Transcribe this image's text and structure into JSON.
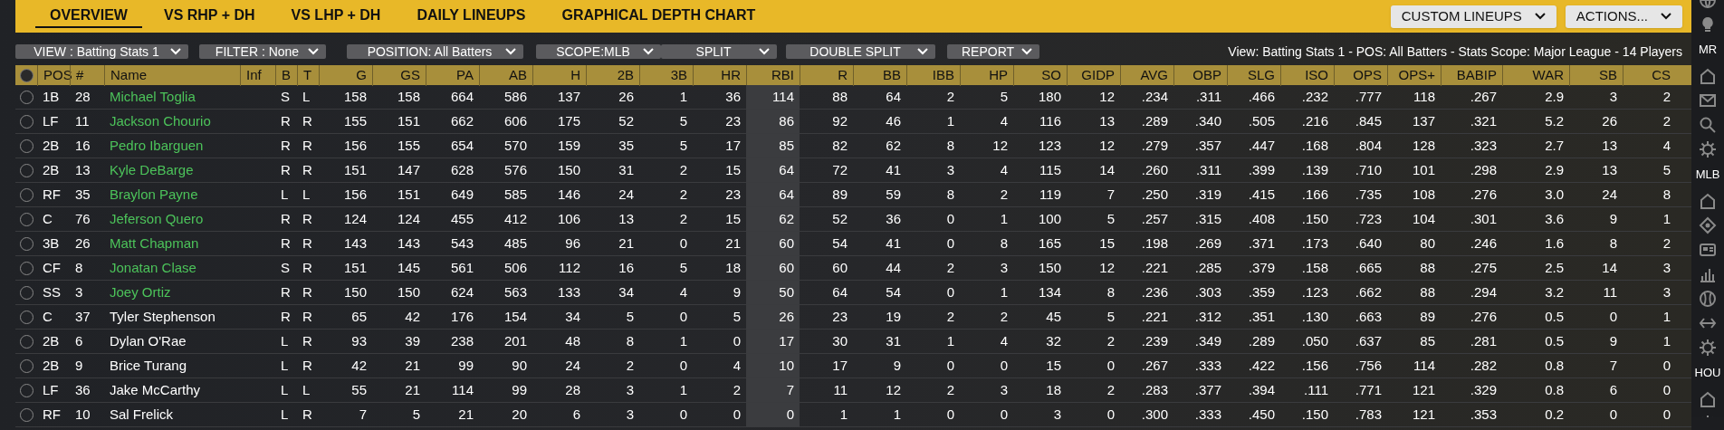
{
  "tabs": [
    {
      "label": "OVERVIEW",
      "selected": true
    },
    {
      "label": "VS RHP + DH",
      "selected": false
    },
    {
      "label": "VS LHP + DH",
      "selected": false
    },
    {
      "label": "DAILY LINEUPS",
      "selected": false
    },
    {
      "label": "GRAPHICAL DEPTH CHART",
      "selected": false
    }
  ],
  "header_buttons": [
    "CUSTOM LINEUPS",
    "ACTIONS..."
  ],
  "filters": [
    {
      "label": "VIEW : Batting Stats 1"
    },
    {
      "label": "FILTER : None"
    },
    {
      "label": "POSITION: All Batters"
    },
    {
      "label": "SCOPE:MLB"
    },
    {
      "label": "SPLIT"
    },
    {
      "label": "DOUBLE SPLIT"
    },
    {
      "label": "REPORT"
    }
  ],
  "summary": "View: Batting Stats 1 - POS: All Batters - Stats Scope: Major League - 14 Players",
  "select_all": {
    "selected": false
  },
  "columns": [
    {
      "label": "POS",
      "kind": "text"
    },
    {
      "label": "#",
      "kind": "text"
    },
    {
      "label": "Name",
      "kind": "name"
    },
    {
      "label": "Inf",
      "kind": "empty"
    },
    {
      "label": "B",
      "kind": "text"
    },
    {
      "label": "T",
      "kind": "text"
    },
    {
      "label": "G",
      "kind": "num"
    },
    {
      "label": "GS",
      "kind": "num"
    },
    {
      "label": "PA",
      "kind": "num"
    },
    {
      "label": "AB",
      "kind": "num"
    },
    {
      "label": "H",
      "kind": "num"
    },
    {
      "label": "2B",
      "kind": "num"
    },
    {
      "label": "3B",
      "kind": "num"
    },
    {
      "label": "HR",
      "kind": "num"
    },
    {
      "label": "RBI",
      "kind": "num",
      "sorted": true
    },
    {
      "label": "R",
      "kind": "num"
    },
    {
      "label": "BB",
      "kind": "num"
    },
    {
      "label": "IBB",
      "kind": "num"
    },
    {
      "label": "HP",
      "kind": "num"
    },
    {
      "label": "SO",
      "kind": "num"
    },
    {
      "label": "GIDP",
      "kind": "num"
    },
    {
      "label": "AVG",
      "kind": "num"
    },
    {
      "label": "OBP",
      "kind": "num"
    },
    {
      "label": "SLG",
      "kind": "num"
    },
    {
      "label": "ISO",
      "kind": "num"
    },
    {
      "label": "OPS",
      "kind": "num"
    },
    {
      "label": "OPS+",
      "kind": "num"
    },
    {
      "label": "BABIP",
      "kind": "num"
    },
    {
      "label": "WAR",
      "kind": "num"
    },
    {
      "label": "SB",
      "kind": "num"
    },
    {
      "label": "CS",
      "kind": "num"
    }
  ],
  "rows": [
    {
      "selected": false,
      "highlighted": true,
      "cells": [
        "1B",
        "28",
        "Michael Toglia",
        "S",
        "L",
        "158",
        "158",
        "664",
        "586",
        "137",
        "26",
        "1",
        "36",
        "114",
        "88",
        "64",
        "2",
        "5",
        "180",
        "12",
        ".234",
        ".311",
        ".466",
        ".232",
        ".777",
        "118",
        ".267",
        "2.9",
        "3",
        "2"
      ]
    },
    {
      "selected": false,
      "highlighted": true,
      "cells": [
        "LF",
        "11",
        "Jackson Chourio",
        "R",
        "R",
        "155",
        "151",
        "662",
        "606",
        "175",
        "52",
        "5",
        "23",
        "86",
        "92",
        "46",
        "1",
        "4",
        "116",
        "13",
        ".289",
        ".340",
        ".505",
        ".216",
        ".845",
        "137",
        ".321",
        "5.2",
        "26",
        "2"
      ]
    },
    {
      "selected": false,
      "highlighted": true,
      "cells": [
        "2B",
        "16",
        "Pedro Ibarguen",
        "R",
        "R",
        "156",
        "155",
        "654",
        "570",
        "159",
        "35",
        "5",
        "17",
        "85",
        "82",
        "62",
        "8",
        "12",
        "123",
        "12",
        ".279",
        ".357",
        ".447",
        ".168",
        ".804",
        "128",
        ".323",
        "2.7",
        "13",
        "4"
      ]
    },
    {
      "selected": false,
      "highlighted": true,
      "cells": [
        "2B",
        "13",
        "Kyle DeBarge",
        "R",
        "R",
        "151",
        "147",
        "628",
        "576",
        "150",
        "31",
        "2",
        "15",
        "64",
        "72",
        "41",
        "3",
        "4",
        "115",
        "14",
        ".260",
        ".311",
        ".399",
        ".139",
        ".710",
        "101",
        ".298",
        "2.9",
        "13",
        "5"
      ]
    },
    {
      "selected": false,
      "highlighted": true,
      "cells": [
        "RF",
        "35",
        "Braylon Payne",
        "L",
        "L",
        "156",
        "151",
        "649",
        "585",
        "146",
        "24",
        "2",
        "23",
        "64",
        "89",
        "59",
        "8",
        "2",
        "119",
        "7",
        ".250",
        ".319",
        ".415",
        ".166",
        ".735",
        "108",
        ".276",
        "3.0",
        "24",
        "8"
      ]
    },
    {
      "selected": false,
      "highlighted": true,
      "cells": [
        "C",
        "76",
        "Jeferson Quero",
        "R",
        "R",
        "124",
        "124",
        "455",
        "412",
        "106",
        "13",
        "2",
        "15",
        "62",
        "52",
        "36",
        "0",
        "1",
        "100",
        "5",
        ".257",
        ".315",
        ".408",
        ".150",
        ".723",
        "104",
        ".301",
        "3.6",
        "9",
        "1"
      ]
    },
    {
      "selected": false,
      "highlighted": true,
      "cells": [
        "3B",
        "26",
        "Matt Chapman",
        "R",
        "R",
        "143",
        "143",
        "543",
        "485",
        "96",
        "21",
        "0",
        "21",
        "60",
        "54",
        "41",
        "0",
        "8",
        "165",
        "15",
        ".198",
        ".269",
        ".371",
        ".173",
        ".640",
        "80",
        ".246",
        "1.6",
        "8",
        "2"
      ]
    },
    {
      "selected": false,
      "highlighted": true,
      "cells": [
        "CF",
        "8",
        "Jonatan Clase",
        "S",
        "R",
        "151",
        "145",
        "561",
        "506",
        "112",
        "16",
        "5",
        "18",
        "60",
        "60",
        "44",
        "2",
        "3",
        "150",
        "12",
        ".221",
        ".285",
        ".379",
        ".158",
        ".665",
        "88",
        ".275",
        "2.5",
        "14",
        "3"
      ]
    },
    {
      "selected": false,
      "highlighted": true,
      "cells": [
        "SS",
        "3",
        "Joey Ortiz",
        "R",
        "R",
        "150",
        "150",
        "624",
        "563",
        "133",
        "34",
        "4",
        "9",
        "50",
        "64",
        "54",
        "0",
        "1",
        "134",
        "8",
        ".236",
        ".303",
        ".359",
        ".123",
        ".662",
        "88",
        ".294",
        "3.2",
        "11",
        "3"
      ]
    },
    {
      "selected": false,
      "highlighted": false,
      "cells": [
        "C",
        "37",
        "Tyler Stephenson",
        "R",
        "R",
        "65",
        "42",
        "176",
        "154",
        "34",
        "5",
        "0",
        "5",
        "26",
        "23",
        "19",
        "2",
        "2",
        "45",
        "5",
        ".221",
        ".312",
        ".351",
        ".130",
        ".663",
        "89",
        ".276",
        "0.5",
        "0",
        "1"
      ]
    },
    {
      "selected": false,
      "highlighted": false,
      "cells": [
        "2B",
        "6",
        "Dylan O'Rae",
        "L",
        "R",
        "93",
        "39",
        "238",
        "201",
        "48",
        "8",
        "1",
        "0",
        "17",
        "30",
        "31",
        "1",
        "4",
        "32",
        "2",
        ".239",
        ".349",
        ".289",
        ".050",
        ".637",
        "85",
        ".281",
        "0.5",
        "9",
        "1"
      ]
    },
    {
      "selected": false,
      "highlighted": false,
      "cells": [
        "2B",
        "9",
        "Brice Turang",
        "L",
        "R",
        "42",
        "21",
        "99",
        "90",
        "24",
        "2",
        "0",
        "4",
        "10",
        "17",
        "9",
        "0",
        "0",
        "15",
        "0",
        ".267",
        ".333",
        ".422",
        ".156",
        ".756",
        "114",
        ".282",
        "0.8",
        "7",
        "0"
      ]
    },
    {
      "selected": false,
      "highlighted": false,
      "cells": [
        "LF",
        "36",
        "Jake McCarthy",
        "L",
        "L",
        "55",
        "21",
        "114",
        "99",
        "28",
        "3",
        "1",
        "2",
        "7",
        "11",
        "12",
        "2",
        "3",
        "18",
        "2",
        ".283",
        ".377",
        ".394",
        ".111",
        ".771",
        "121",
        ".329",
        "0.8",
        "6",
        "0"
      ]
    },
    {
      "selected": false,
      "highlighted": false,
      "cells": [
        "RF",
        "10",
        "Sal Frelick",
        "L",
        "R",
        "7",
        "5",
        "21",
        "20",
        "6",
        "3",
        "0",
        "0",
        "0",
        "1",
        "1",
        "0",
        "0",
        "3",
        "0",
        ".300",
        ".333",
        ".450",
        ".150",
        ".783",
        "121",
        ".353",
        "0.2",
        "0",
        "0"
      ]
    }
  ],
  "sidebar_sections": [
    {
      "label": "MR"
    },
    {
      "label": "MLB"
    },
    {
      "label": "HOU"
    }
  ]
}
